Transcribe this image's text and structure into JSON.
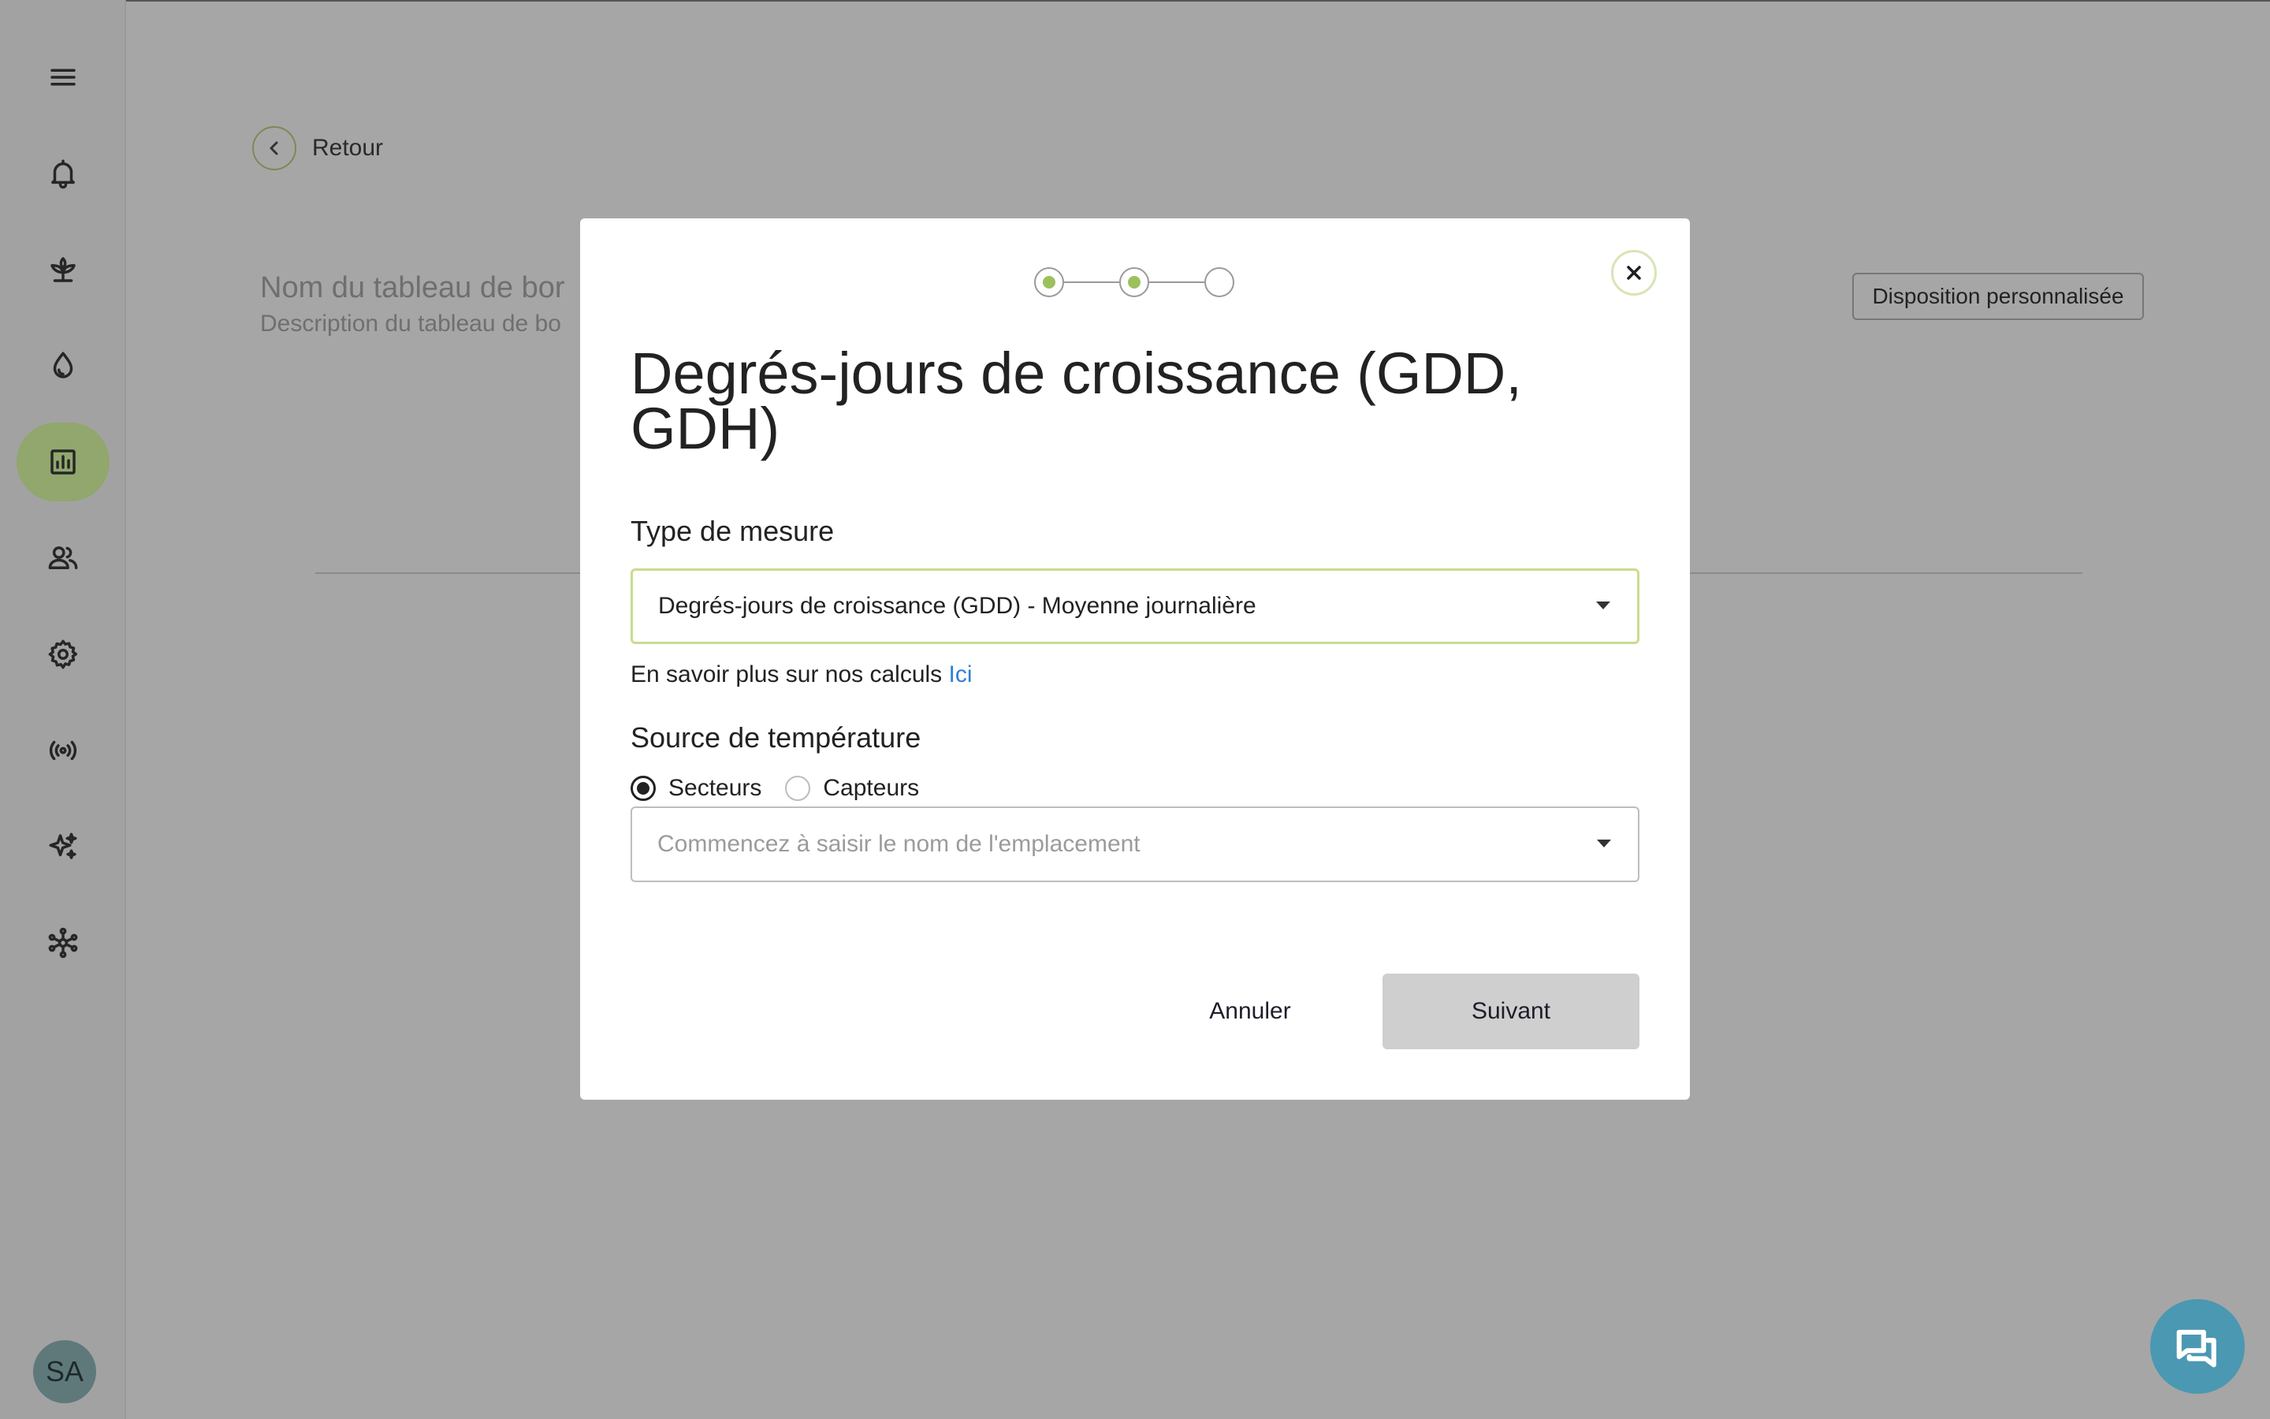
{
  "page": {
    "back_label": "Retour",
    "dashboard_title": "Nom du tableau de bor",
    "dashboard_description": "Description du tableau de bo",
    "custom_layout_label": "Disposition personnalisée"
  },
  "sidebar": {
    "items": [
      {
        "icon": "menu-icon"
      },
      {
        "icon": "bell-icon"
      },
      {
        "icon": "plant-icon"
      },
      {
        "icon": "water-drop-icon"
      },
      {
        "icon": "chart-icon",
        "active": true
      },
      {
        "icon": "users-icon"
      },
      {
        "icon": "gear-icon"
      },
      {
        "icon": "broadcast-icon"
      },
      {
        "icon": "sparkle-icon"
      },
      {
        "icon": "network-icon"
      }
    ],
    "avatar_initials": "SA"
  },
  "modal": {
    "steps": [
      {
        "state": "done"
      },
      {
        "state": "current"
      },
      {
        "state": "pending"
      }
    ],
    "title": "Degrés-jours de croissance (GDD, GDH)",
    "measure_label": "Type de mesure",
    "measure_value": "Degrés-jours de croissance (GDD)  -  Moyenne journalière",
    "helper_text": "En savoir plus sur nos calculs ",
    "helper_link": "Ici",
    "source_label": "Source de température",
    "radio_options": [
      "Secteurs",
      "Capteurs"
    ],
    "radio_selected": "Secteurs",
    "location_placeholder": "Commencez à saisir le nom de l'emplacement",
    "cancel_label": "Annuler",
    "next_label": "Suivant"
  },
  "colors": {
    "accent": "#9cc05b",
    "active_nav": "#91a76d",
    "link": "#2f7fd8",
    "chat": "#4b98b2"
  }
}
